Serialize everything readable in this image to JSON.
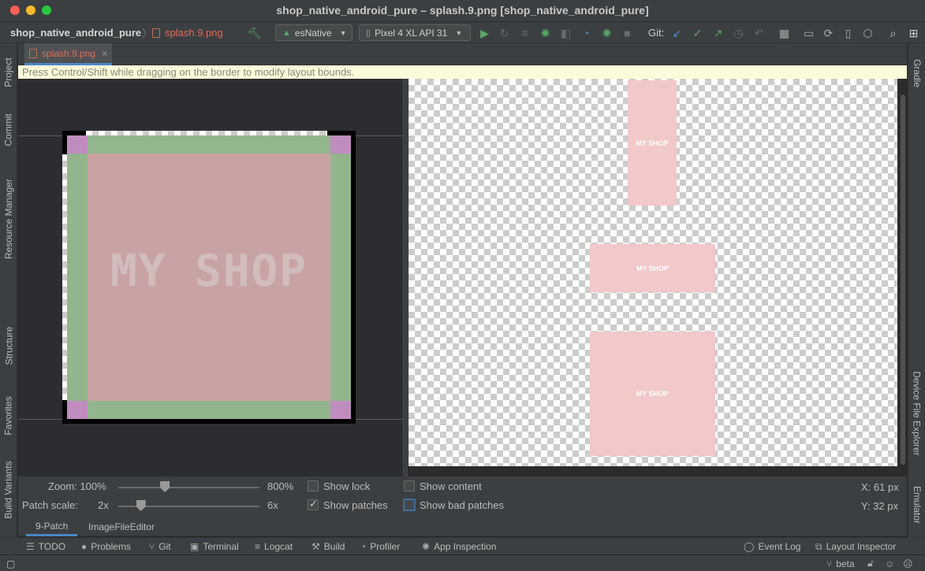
{
  "window": {
    "title": "shop_native_android_pure – splash.9.png [shop_native_android_pure]"
  },
  "toolbar": {
    "project": "shop_native_android_pure",
    "file": "splash.9.png",
    "config": "esNative",
    "device": "Pixel 4 XL API 31",
    "git_label": "Git:"
  },
  "left_tabs": [
    "Project",
    "Commit",
    "Resource Manager",
    "Structure",
    "Favorites",
    "Build Variants"
  ],
  "right_tabs": [
    "Gradle",
    "Device File Explorer",
    "Emulator"
  ],
  "editor": {
    "tab_label": "splash.9.png",
    "tab_close": "×",
    "hint": "Press Control/Shift while dragging on the border to modify layout bounds.",
    "patch_text": "MY SHOP"
  },
  "preview": {
    "label_tall": "MY SHOP",
    "label_wide": "MY SHOP",
    "label_big": "MY SHOP"
  },
  "controls": {
    "zoom_label": "Zoom: 100%",
    "zoom_max": "800%",
    "zoom_value_fraction": 0.33,
    "patch_scale_label": "Patch scale:",
    "patch_min": "2x",
    "patch_max": "6x",
    "patch_value_fraction": 0.16,
    "show_lock": "Show lock",
    "show_lock_checked": false,
    "show_patches": "Show patches",
    "show_patches_checked": true,
    "show_content": "Show content",
    "show_content_checked": false,
    "show_bad_patches": "Show bad patches",
    "show_bad_patches_checked": false,
    "x_readout": "X: 61 px",
    "y_readout": "Y: 32 px"
  },
  "subtabs": [
    "9-Patch",
    "ImageFileEditor"
  ],
  "toolwindows": {
    "todo": "TODO",
    "problems": "Problems",
    "git": "Git",
    "terminal": "Terminal",
    "logcat": "Logcat",
    "build": "Build",
    "profiler": "Profiler",
    "app_inspection": "App Inspection",
    "event_log": "Event Log",
    "layout_inspector": "Layout Inspector"
  },
  "status": {
    "branch": "beta"
  },
  "colors": {
    "accent": "#4a88c7",
    "run_green": "#59a869",
    "patch_green": "#93b58d",
    "patch_pink": "#c08cbf",
    "content_pink": "#f2c8c8"
  }
}
